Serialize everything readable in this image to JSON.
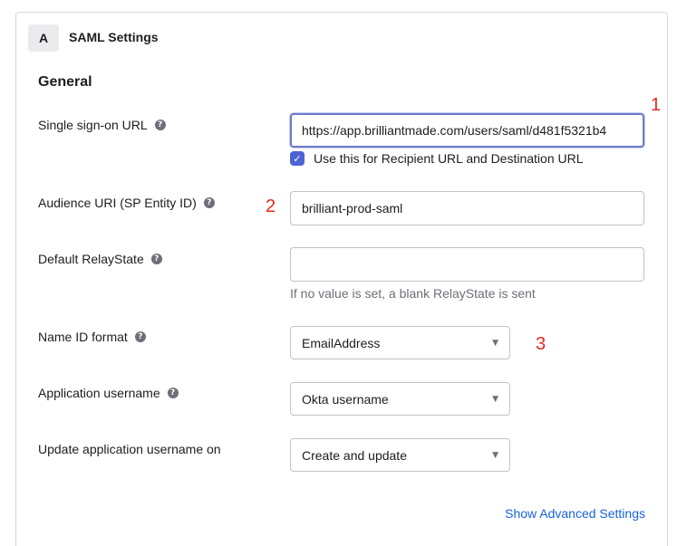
{
  "header": {
    "step": "A",
    "title": "SAML Settings"
  },
  "section": {
    "title": "General"
  },
  "fields": {
    "sso_url": {
      "label": "Single sign-on URL",
      "value": "https://app.brilliantmade.com/users/saml/d481f5321b4",
      "checkbox_label": "Use this for Recipient URL and Destination URL",
      "checked": true
    },
    "audience_uri": {
      "label": "Audience URI (SP Entity ID)",
      "value": "brilliant-prod-saml"
    },
    "relay_state": {
      "label": "Default RelayState",
      "value": "",
      "hint": "If no value is set, a blank RelayState is sent"
    },
    "name_id_format": {
      "label": "Name ID format",
      "selected": "EmailAddress"
    },
    "app_username": {
      "label": "Application username",
      "selected": "Okta username"
    },
    "update_username": {
      "label": "Update application username on",
      "selected": "Create and update"
    }
  },
  "help_glyph": "?",
  "check_glyph": "✓",
  "caret_glyph": "▼",
  "annotations": [
    "1",
    "2",
    "3"
  ],
  "advanced_link": "Show Advanced Settings",
  "colors": {
    "accent": "#4c64d3",
    "link": "#1662dd",
    "annotation": "#e8281e",
    "focus": "#6e79c7"
  }
}
